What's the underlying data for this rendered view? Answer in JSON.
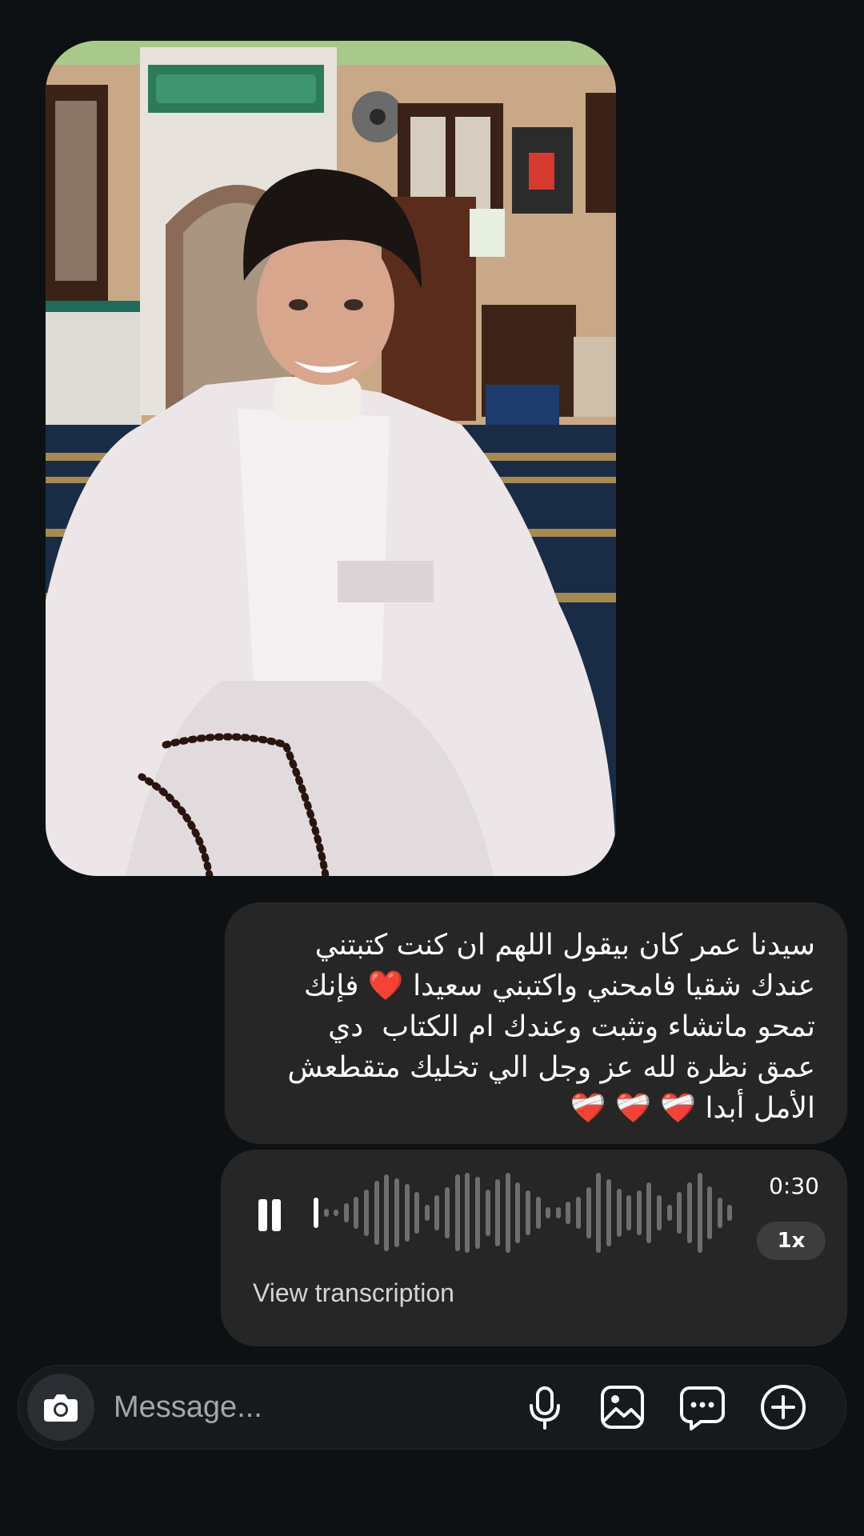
{
  "photo_message": {
    "alt": "photo-message"
  },
  "text_message": {
    "text": "سيدنا عمر كان بيقول اللهم ان كنت كتبتني\nعندك شقيا فامحني واكتبني سعيدا ❤️ فإنك\nتمحو ماتشاء وتثبت وعندك ام الكتاب  دي\nعمق نظرة لله عز وجل الي تخليك متقطعش\nالأمل أبدا ❤️‍🩹 ❤️‍🩹 ❤️‍🩹"
  },
  "voice_message": {
    "duration": "0:30",
    "speed": "1x",
    "view_transcription": "View transcription",
    "progress": 0.03
  },
  "composer": {
    "placeholder": "Message...",
    "value": ""
  },
  "icons": {
    "camera": "camera-icon",
    "mic": "microphone-icon",
    "gallery": "gallery-icon",
    "chat": "chat-bubble-icon",
    "add": "plus-circle-icon"
  },
  "colors": {
    "background": "#0d1114",
    "bubble": "#262626",
    "composer": "#161a1d",
    "waveform_played": "#ffffff",
    "waveform_unplayed": "#6e6e6e"
  }
}
